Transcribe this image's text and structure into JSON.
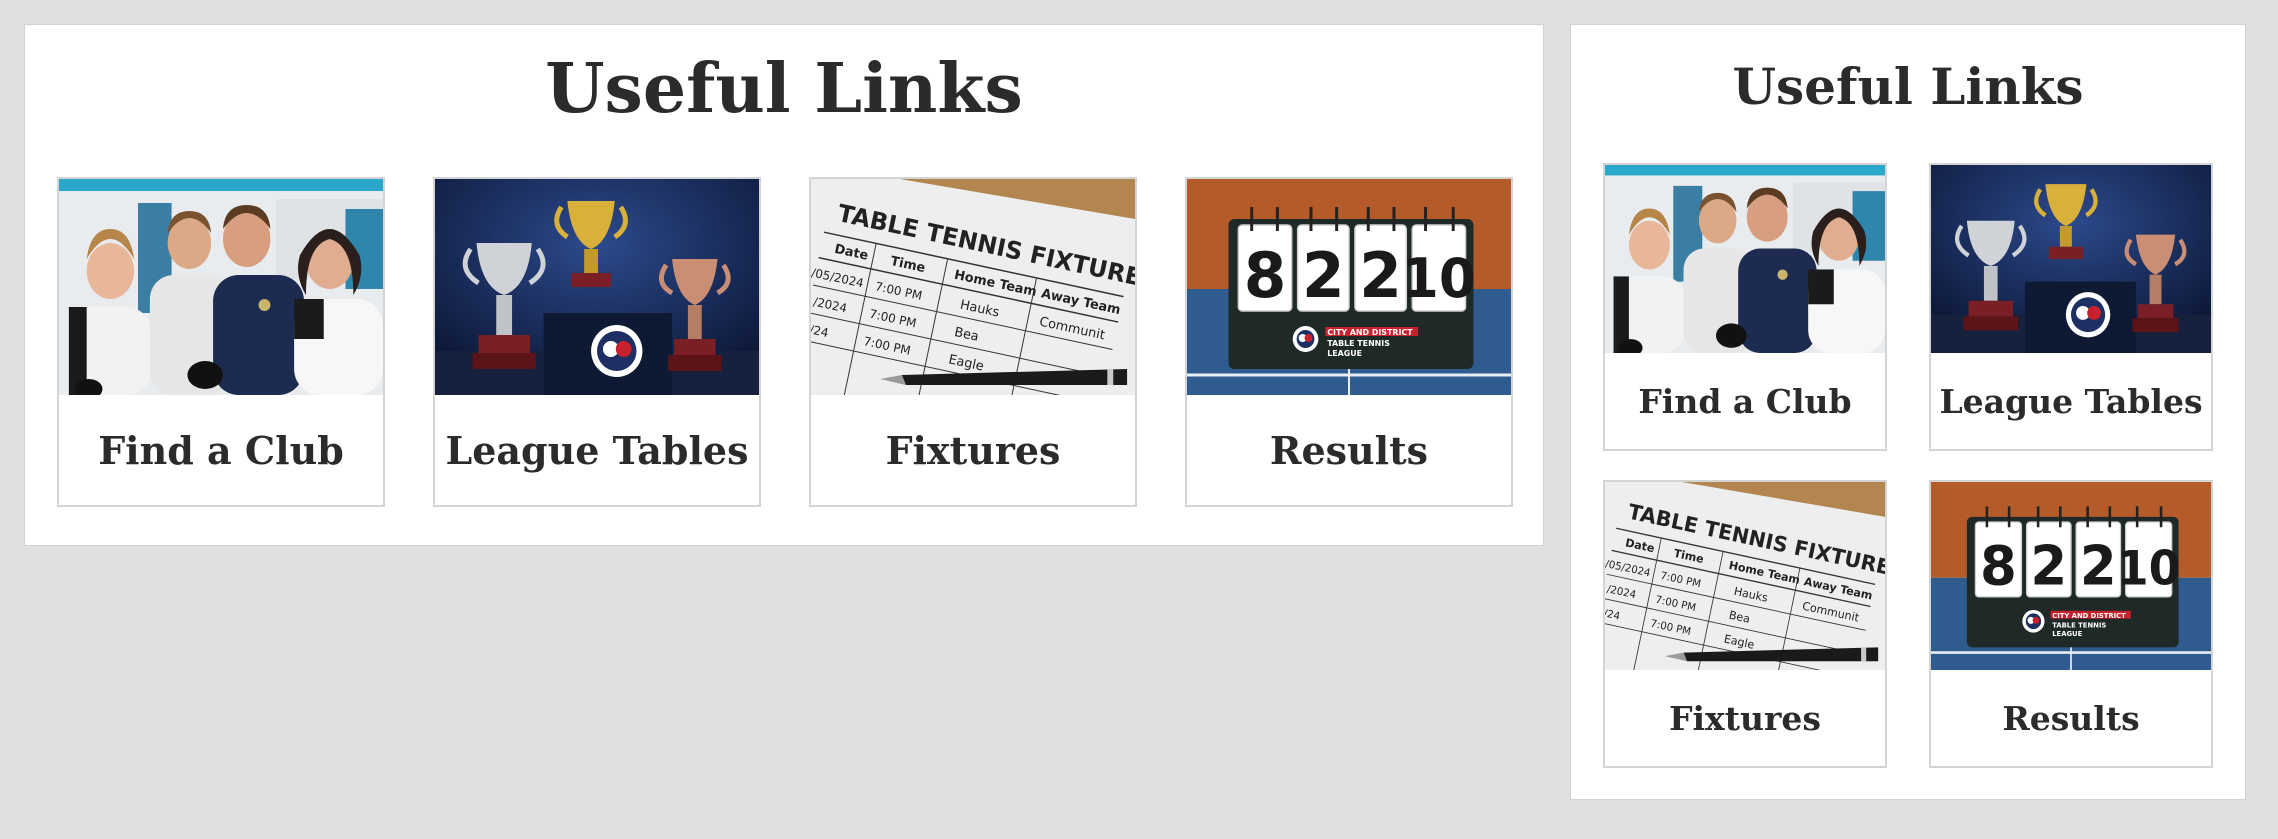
{
  "wide": {
    "heading": "Useful Links",
    "cards": [
      {
        "label": "Find a Club",
        "image": "group-of-players-photo"
      },
      {
        "label": "League Tables",
        "image": "trophies-photo"
      },
      {
        "label": "Fixtures",
        "image": "fixtures-sheet-photo"
      },
      {
        "label": "Results",
        "image": "scoreboard-photo"
      }
    ]
  },
  "narrow": {
    "heading": "Useful Links",
    "cards": [
      {
        "label": "Find a Club",
        "image": "group-of-players-photo"
      },
      {
        "label": "League Tables",
        "image": "trophies-photo"
      },
      {
        "label": "Fixtures",
        "image": "fixtures-sheet-photo"
      },
      {
        "label": "Results",
        "image": "scoreboard-photo"
      }
    ]
  },
  "fixtures_image_text": {
    "title": "TABLE TENNIS FIXTURES",
    "columns": [
      "Date",
      "Time",
      "Home Team",
      "Away Team"
    ],
    "dates": [
      "/05/2024",
      "/2024",
      "/24"
    ],
    "times": [
      "7:00 PM",
      "7:00 PM",
      "7:00 PM"
    ],
    "home": [
      "Hauks",
      "Bea",
      "Eagle"
    ],
    "away": [
      "Communit"
    ]
  },
  "scoreboard_image_text": {
    "digits": [
      "8",
      "2",
      "2",
      "10"
    ],
    "brand_line1": "CITY AND DISTRICT",
    "brand_line2": "TABLE TENNIS",
    "brand_line3": "LEAGUE"
  },
  "colors": {
    "page_bg": "#e0e0e0",
    "panel_bg": "#ffffff",
    "text": "#2b2b2b",
    "navy": "#1d2a4a",
    "table_blue": "#2f5b8f",
    "wall_orange": "#b55b2a",
    "brand_red": "#c8202c"
  }
}
